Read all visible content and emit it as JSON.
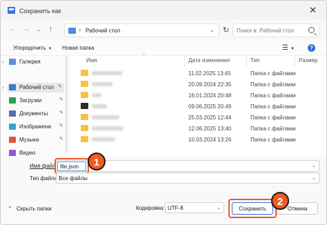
{
  "window": {
    "title": "Сохранить как"
  },
  "address": {
    "path_label": "Рабочий стол",
    "search_placeholder": "Поиск в: Рабочий стол"
  },
  "toolbar": {
    "organize": "Упорядочить",
    "new_folder": "Новая папка"
  },
  "sidebar": {
    "items": [
      {
        "label": "Галерея",
        "color": "#5a8fd8"
      },
      {
        "label": "Рабочий стол",
        "color": "#3b78d8"
      },
      {
        "label": "Загрузки",
        "color": "#2d9f5a"
      },
      {
        "label": "Документы",
        "color": "#5a6fa8"
      },
      {
        "label": "Изображени",
        "color": "#3aa0d8"
      },
      {
        "label": "Музыка",
        "color": "#e0563f"
      },
      {
        "label": "Видео",
        "color": "#8a5ad8"
      }
    ]
  },
  "columns": {
    "name": "Имя",
    "date": "Дата изменения",
    "type": "Тип",
    "size": "Размер"
  },
  "files": [
    {
      "date": "11.02.2025 13:45",
      "type": "Папка с файлами",
      "icon": "folder"
    },
    {
      "date": "20.09.2024 22:35",
      "type": "Папка с файлами",
      "icon": "folder"
    },
    {
      "date": "16.01.2024 20:48",
      "type": "Папка с файлами",
      "icon": "folder"
    },
    {
      "date": "09.06.2025 20:49",
      "type": "Папка с файлами",
      "icon": "special"
    },
    {
      "date": "25.03.2025 12:44",
      "type": "Папка с файлами",
      "icon": "folder"
    },
    {
      "date": "12.06.2025 13:40",
      "type": "Папка с файлами",
      "icon": "folder"
    },
    {
      "date": "10.03.2024 13:26",
      "type": "Папка с файлами",
      "icon": "folder"
    }
  ],
  "form": {
    "filename_label": "Имя файла:",
    "filename_value": "file.json",
    "filetype_label": "Тип файла:",
    "filetype_value": "Все файлы",
    "hide_folders": "Скрыть папки",
    "encoding_label": "Кодировка:",
    "encoding_value": "UTF-8",
    "save": "Сохранить",
    "cancel": "Отмена"
  },
  "markers": {
    "one": "1",
    "two": "2"
  },
  "colors": {
    "accent": "#f05a24",
    "folder": "#f5c242",
    "help": "#2d6fd6"
  }
}
